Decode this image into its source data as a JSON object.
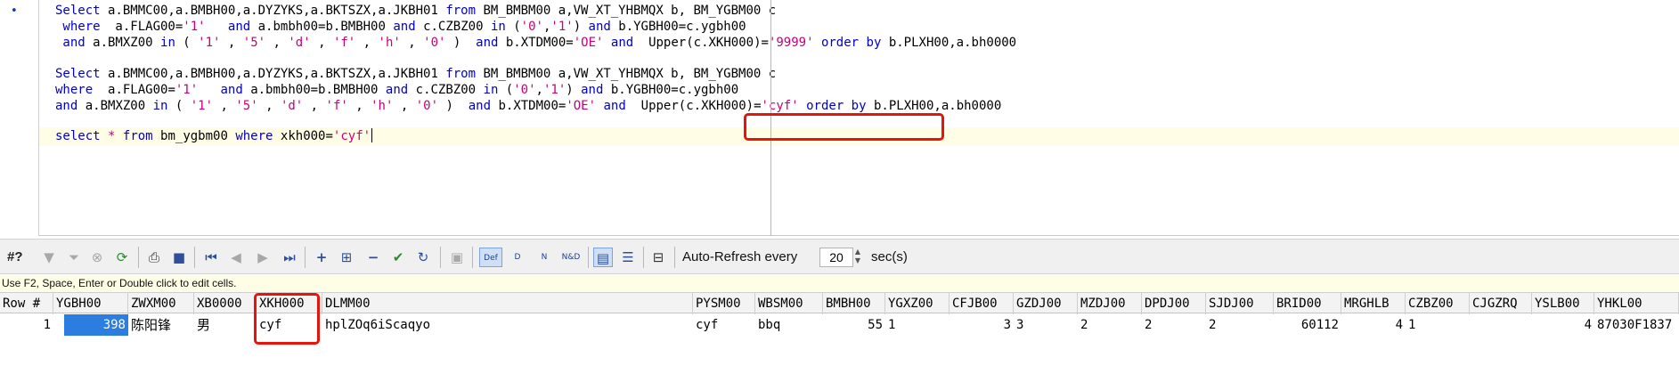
{
  "editor": {
    "lines": {
      "q1_l1": [
        "Select",
        " a.BMMC00,a.BMBH00,a.DYZYKS,a.BKTSZX,a.JKBH01 ",
        "from",
        " BM_BMBM00 a,VW_XT_YHBMQX b, BM_YGBM00 c"
      ],
      "q1_l2": [
        " where",
        "  a.FLAG00=",
        "'1'",
        "   ",
        "and",
        " a.bmbh00=b.BMBH00 ",
        "and",
        " c.CZBZ00 ",
        "in",
        " (",
        "'0'",
        ",",
        "'1'",
        ") ",
        "and",
        " b.YGBH00=c.ygbh00"
      ],
      "q1_l3": [
        " and",
        " a.BMXZ00 ",
        "in",
        " ( ",
        "'1'",
        " , ",
        "'5'",
        " , ",
        "'d'",
        " , ",
        "'f'",
        " , ",
        "'h'",
        " , ",
        "'0'",
        " )  ",
        "and",
        " b.XTDM00=",
        "'OE'",
        " ",
        "and",
        "  ",
        "Upper",
        "(c.XKH000)=",
        "'9999'",
        " ",
        "order by",
        " b.PLXH00,a.bh0000"
      ],
      "q2_l1": [
        "Select",
        " a.BMMC00,a.BMBH00,a.DYZYKS,a.BKTSZX,a.JKBH01 ",
        "from",
        " BM_BMBM00 a,VW_XT_YHBMQX b, BM_YGBM00 c"
      ],
      "q2_l2": [
        "where",
        "  a.FLAG00=",
        "'1'",
        "   ",
        "and",
        " a.bmbh00=b.BMBH00 ",
        "and",
        " c.CZBZ00 ",
        "in",
        " (",
        "'0'",
        ",",
        "'1'",
        ") ",
        "and",
        " b.YGBH00=c.ygbh00"
      ],
      "q2_l3": [
        "and",
        " a.BMXZ00 ",
        "in",
        " ( ",
        "'1'",
        " , ",
        "'5'",
        " , ",
        "'d'",
        " , ",
        "'f'",
        " , ",
        "'h'",
        " , ",
        "'0'",
        " )  ",
        "and",
        " b.XTDM00=",
        "'OE'",
        " ",
        "and",
        "  ",
        "Upper",
        "(c.XKH000)=",
        "'cyf'",
        " ",
        "order by",
        " b.PLXH00,a.bh0000"
      ],
      "q3_l1": [
        "select",
        " ",
        "*",
        " ",
        "from",
        " bm_ygbm00 ",
        "where",
        " xkh000=",
        "'cyf'"
      ]
    },
    "token_kinds": {
      "q1_l1": [
        "kw",
        "t",
        "kw",
        "t"
      ],
      "q1_l2": [
        "kw",
        "t",
        "str",
        "t",
        "kw",
        "t",
        "kw",
        "t",
        "kw",
        "t",
        "str",
        "t",
        "str",
        "t",
        "kw",
        "t"
      ],
      "q1_l3": [
        "kw",
        "t",
        "kw",
        "t",
        "str",
        "t",
        "str",
        "t",
        "str",
        "t",
        "str",
        "t",
        "str",
        "t",
        "str",
        "t",
        "kw",
        "t",
        "str",
        "t",
        "kw",
        "t",
        "t",
        "t",
        "str",
        "t",
        "kw",
        "t"
      ],
      "q2_l1": [
        "kw",
        "t",
        "kw",
        "t"
      ],
      "q2_l2": [
        "kw",
        "t",
        "str",
        "t",
        "kw",
        "t",
        "kw",
        "t",
        "kw",
        "t",
        "str",
        "t",
        "str",
        "t",
        "kw",
        "t"
      ],
      "q2_l3": [
        "kw",
        "t",
        "kw",
        "t",
        "str",
        "t",
        "str",
        "t",
        "str",
        "t",
        "str",
        "t",
        "str",
        "t",
        "str",
        "t",
        "kw",
        "t",
        "str",
        "t",
        "kw",
        "t",
        "t",
        "t",
        "str",
        "t",
        "kw",
        "t"
      ],
      "q3_l1": [
        "kw",
        "t",
        "op",
        "t",
        "kw",
        "t",
        "kw",
        "t",
        "str"
      ]
    }
  },
  "toolbar": {
    "rowcount": "#?",
    "auto_refresh_label": "Auto-Refresh every",
    "refresh_value": "20",
    "sec_label": "sec(s)",
    "icons": [
      "filter-icon",
      "clear-filter-icon",
      "cancel-icon",
      "refresh-icon",
      "print-icon",
      "save-icon",
      "first-record-icon",
      "prior-record-icon",
      "next-record-icon",
      "last-record-icon",
      "insert-record-icon",
      "insert-multiple-icon",
      "delete-record-icon",
      "post-changes-icon",
      "refresh-record-icon",
      "single-record-icon",
      "default-mode-icon",
      "delete-mode-icon",
      "new-mode-icon",
      "new-delete-mode-icon",
      "grid-view-icon",
      "record-view-icon",
      "text-view-icon"
    ],
    "small_labels": {
      "def": "Def",
      "d": "D",
      "n": "N",
      "nd": "N&D"
    }
  },
  "hint": "Use F2, Space, Enter or Double click to edit cells.",
  "grid": {
    "columns": [
      "Row #",
      "YGBH00",
      "ZWXM00",
      "XB0000",
      "XKH000",
      "DLMM00",
      "PYSM00",
      "WBSM00",
      "BMBH00",
      "YGXZ00",
      "CFJB00",
      "GZDJ00",
      "MZDJ00",
      "DPDJ00",
      "SJDJ00",
      "BRID00",
      "MRGHLB",
      "CZBZ00",
      "CJGZRQ",
      "YSLB00",
      "YHKL00"
    ],
    "row": [
      "1",
      "398",
      "陈阳锋",
      "男",
      "cyf",
      "hplZOq6iScaqyo",
      "cyf",
      "bbq",
      "55",
      "1",
      "3",
      "3",
      "2",
      "2",
      "2",
      "60112",
      "4",
      "1",
      "",
      "4",
      "87030F1837"
    ]
  },
  "colors": {
    "keyword": "#0000c8",
    "string": "#c8007a",
    "highlight_box": "#e5140c",
    "selected_cell": "#2b7de0",
    "current_line": "#fffde6"
  }
}
